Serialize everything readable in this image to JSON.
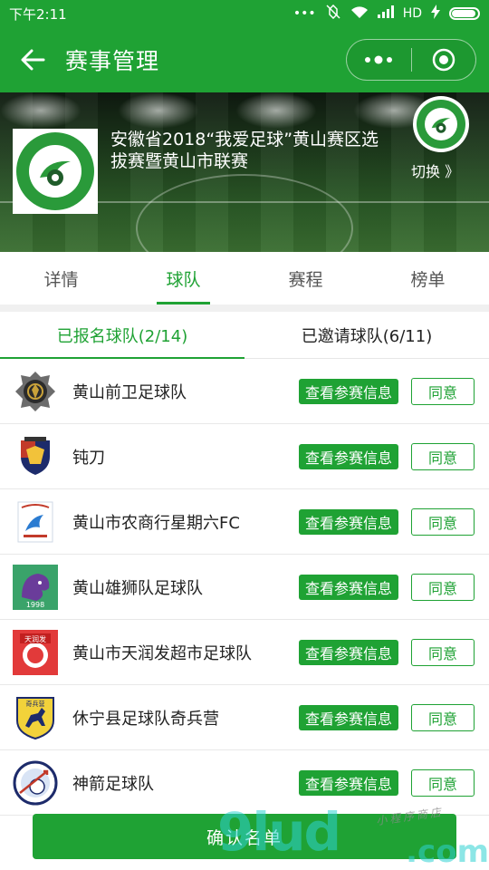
{
  "status_bar": {
    "time": "下午2:11",
    "network": "HD"
  },
  "nav": {
    "title": "赛事管理"
  },
  "banner": {
    "title": "安徽省2018“我爱足球”黄山赛区选拔赛暨黄山市联赛",
    "switch_label": "切换 》"
  },
  "tabs": [
    {
      "label": "详情"
    },
    {
      "label": "球队"
    },
    {
      "label": "赛程"
    },
    {
      "label": "榜单"
    }
  ],
  "subtabs": [
    {
      "label": "已报名球队(2/14)"
    },
    {
      "label": "已邀请球队(6/11)"
    }
  ],
  "teams": [
    {
      "name": "黄山前卫足球队",
      "info_label": "查看参赛信息",
      "agree_label": "同意"
    },
    {
      "name": "钝刀",
      "info_label": "查看参赛信息",
      "agree_label": "同意"
    },
    {
      "name": "黄山市农商行星期六FC",
      "info_label": "查看参赛信息",
      "agree_label": "同意"
    },
    {
      "name": "黄山雄狮队足球队",
      "info_label": "查看参赛信息",
      "agree_label": "同意",
      "logo_text": "1998"
    },
    {
      "name": "黄山市天润发超市足球队",
      "info_label": "查看参赛信息",
      "agree_label": "同意",
      "logo_text": "天润发"
    },
    {
      "name": "休宁县足球队奇兵营",
      "info_label": "查看参赛信息",
      "agree_label": "同意",
      "logo_text": "奇兵营"
    },
    {
      "name": "神箭足球队",
      "info_label": "查看参赛信息",
      "agree_label": "同意"
    }
  ],
  "confirm_label": "确认名单",
  "watermark": {
    "big": "9lud",
    "small": ".com",
    "tag": "小程序商店"
  },
  "colors": {
    "primary": "#1fa234",
    "text": "#222222",
    "border": "#e8e8e8"
  }
}
